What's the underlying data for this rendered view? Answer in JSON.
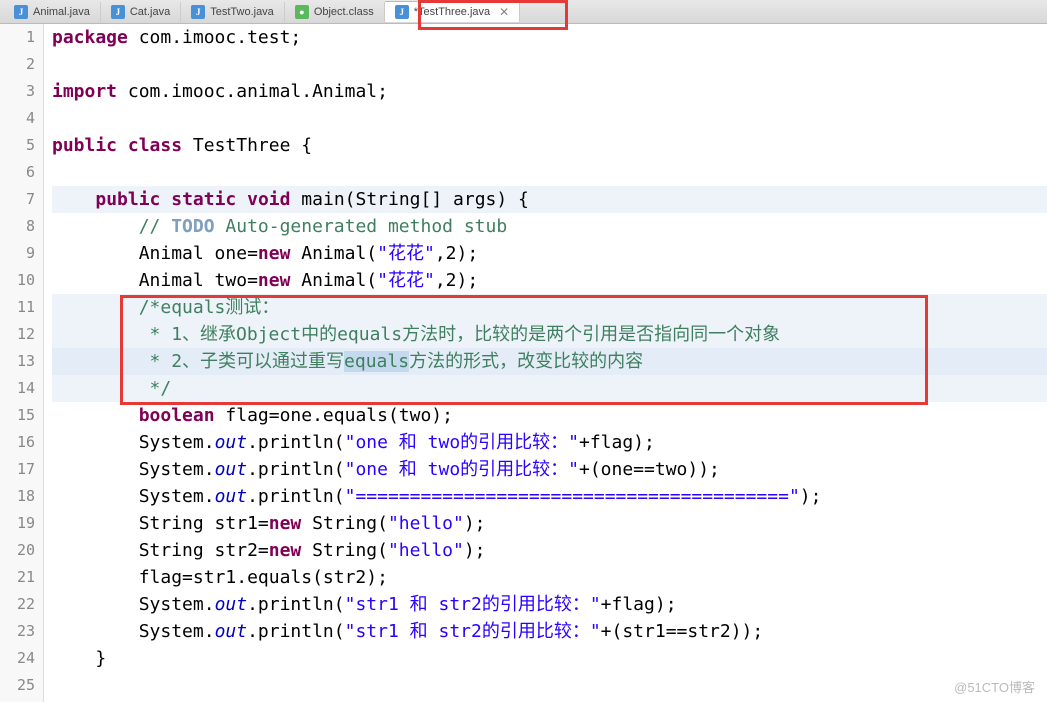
{
  "tabs": [
    {
      "label": "Animal.java",
      "iconType": "java"
    },
    {
      "label": "Cat.java",
      "iconType": "java"
    },
    {
      "label": "TestTwo.java",
      "iconType": "java"
    },
    {
      "label": "Object.class",
      "iconType": "class"
    },
    {
      "label": "*TestThree.java",
      "iconType": "java",
      "active": true
    }
  ],
  "lineNumbers": [
    "1",
    "2",
    "3",
    "4",
    "5",
    "6",
    "7",
    "8",
    "9",
    "10",
    "11",
    "12",
    "13",
    "14",
    "15",
    "16",
    "17",
    "18",
    "19",
    "20",
    "21",
    "22",
    "23",
    "24",
    "25"
  ],
  "code": {
    "l1a": "package",
    "l1b": " com.imooc.test;",
    "l3a": "import",
    "l3b": " com.imooc.animal.Animal;",
    "l5a": "public",
    "l5b": " ",
    "l5c": "class",
    "l5d": " TestThree {",
    "l7a": "    ",
    "l7b": "public",
    "l7c": " ",
    "l7d": "static",
    "l7e": " ",
    "l7f": "void",
    "l7g": " main(String[] args) {",
    "l8a": "        ",
    "l8b": "// ",
    "l8c": "TODO",
    "l8d": " Auto-generated method stub",
    "l9a": "        Animal one=",
    "l9b": "new",
    "l9c": " Animal(",
    "l9d": "\"花花\"",
    "l9e": ",2);",
    "l10a": "        Animal two=",
    "l10b": "new",
    "l10c": " Animal(",
    "l10d": "\"花花\"",
    "l10e": ",2);",
    "l11a": "        ",
    "l11b": "/*equals测试：",
    "l12a": "         * 1、继承Object中的equals方法时，比较的是两个引用是否指向同一个对象",
    "l13a": "         * 2、子类可以通过重写",
    "l13sel": "equals",
    "l13b": "方法的形式，改变比较的内容",
    "l14a": "         */",
    "l15a": "        ",
    "l15b": "boolean",
    "l15c": " flag=one.equals(two);",
    "l16a": "        System.",
    "l16b": "out",
    "l16c": ".println(",
    "l16d": "\"one 和 two的引用比较：\"",
    "l16e": "+flag);",
    "l17a": "        System.",
    "l17b": "out",
    "l17c": ".println(",
    "l17d": "\"one 和 two的引用比较：\"",
    "l17e": "+(one==two));",
    "l18a": "        System.",
    "l18b": "out",
    "l18c": ".println(",
    "l18d": "\"========================================\"",
    "l18e": ");",
    "l19a": "        String str1=",
    "l19b": "new",
    "l19c": " String(",
    "l19d": "\"hello\"",
    "l19e": ");",
    "l20a": "        String str2=",
    "l20b": "new",
    "l20c": " String(",
    "l20d": "\"hello\"",
    "l20e": ");",
    "l21a": "        flag=str1.equals(str2);",
    "l22a": "        System.",
    "l22b": "out",
    "l22c": ".println(",
    "l22d": "\"str1 和 str2的引用比较：\"",
    "l22e": "+flag);",
    "l23a": "        System.",
    "l23b": "out",
    "l23c": ".println(",
    "l23d": "\"str1 和 str2的引用比较：\"",
    "l23e": "+(str1==str2));",
    "l24a": "    }"
  },
  "watermark": "@51CTO博客",
  "icons": {
    "java": "J",
    "class": "●",
    "close": "✕"
  }
}
